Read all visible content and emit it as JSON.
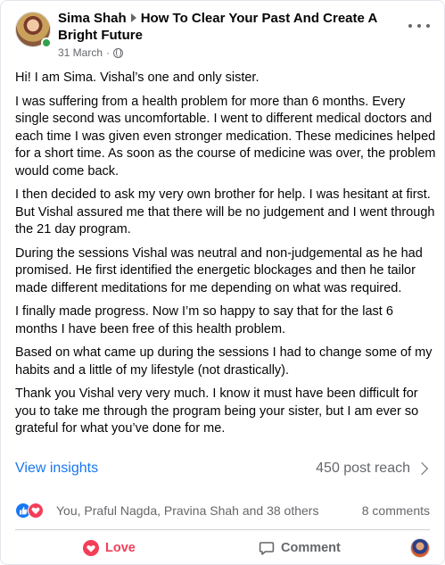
{
  "post": {
    "author": "Sima Shah",
    "group_title": "How To Clear Your Past And Create A Bright Future",
    "date": "31 March",
    "dot": "·",
    "more_icon": "more-horizontal-icon",
    "paragraphs": [
      "Hi! I am Sima. Vishal’s one and only sister.",
      "I was suffering from a health problem for more than 6 months. Every single second was uncomfortable. I went to different medical doctors and each time I was given even stronger medication. These medicines helped for a short time. As soon as the course of medicine was over, the problem would come back.",
      "I then decided to ask my very own brother for help. I was hesitant at first. But Vishal assured me that there will be no judgement and I went through the 21 day program.",
      "During the sessions Vishal was neutral and non-judgemental as he had promised. He first identified the energetic blockages and then he tailor made different meditations for me depending on what was required.",
      "I finally made progress. Now I’m so happy to say that for the last 6 months I have been free of this health problem.",
      "Based on what came up during the sessions I had to change some of my habits and a little of my lifestyle (not drastically).",
      "Thank you Vishal very very much. I know it must have been difficult for you to take me through the program being your sister, but I am ever so grateful for what you’ve done for me."
    ]
  },
  "insights": {
    "view_label": "View insights",
    "reach_label": "450 post reach"
  },
  "reactions": {
    "names": "You, Praful Nagda, Pravina Shah and 38 others",
    "comments": "8 comments"
  },
  "actions": {
    "love_label": "Love",
    "comment_label": "Comment"
  },
  "colors": {
    "accent": "#1877f2",
    "love": "#f33e58",
    "muted": "#65676b",
    "online": "#31a24c"
  }
}
